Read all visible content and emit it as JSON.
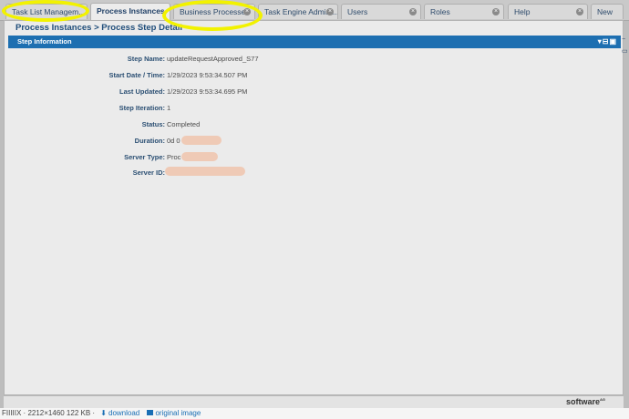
{
  "tabs": [
    {
      "label": "Task List Managem...",
      "caret": "▾"
    },
    {
      "label": "Process Instances",
      "caret": "▾"
    },
    {
      "label": "Business Processes",
      "close": "×"
    },
    {
      "label": "Task Engine Admini...",
      "close": "×"
    },
    {
      "label": "Users",
      "close": "×"
    },
    {
      "label": "Roles",
      "close": "×"
    },
    {
      "label": "Help",
      "close": "×"
    },
    {
      "label": "New"
    }
  ],
  "breadcrumb": "Process Instances > Process Step Detail",
  "panel": {
    "title": "Step Information",
    "controls": "▾⊟▣"
  },
  "fields": [
    {
      "label": "Step Name:",
      "value": "updateRequestApproved_S77"
    },
    {
      "label": "Start Date / Time:",
      "value": "1/29/2023 9:53:34.507 PM"
    },
    {
      "label": "Last Updated:",
      "value": "1/29/2023 9:53:34.695 PM"
    },
    {
      "label": "Step Iteration:",
      "value": "1"
    },
    {
      "label": "Status:",
      "value": "Completed"
    },
    {
      "label": "Duration:",
      "value": "0d 0"
    },
    {
      "label": "Server Type:",
      "value": "Proc"
    },
    {
      "label": "Server ID:",
      "value": ""
    }
  ],
  "footer": {
    "logo": "software",
    "logo_sup": "AG"
  },
  "bottombar": {
    "prefix": "FIIIIIX · 2212×1460 122 KB ·",
    "download": "download",
    "original": "original image"
  }
}
